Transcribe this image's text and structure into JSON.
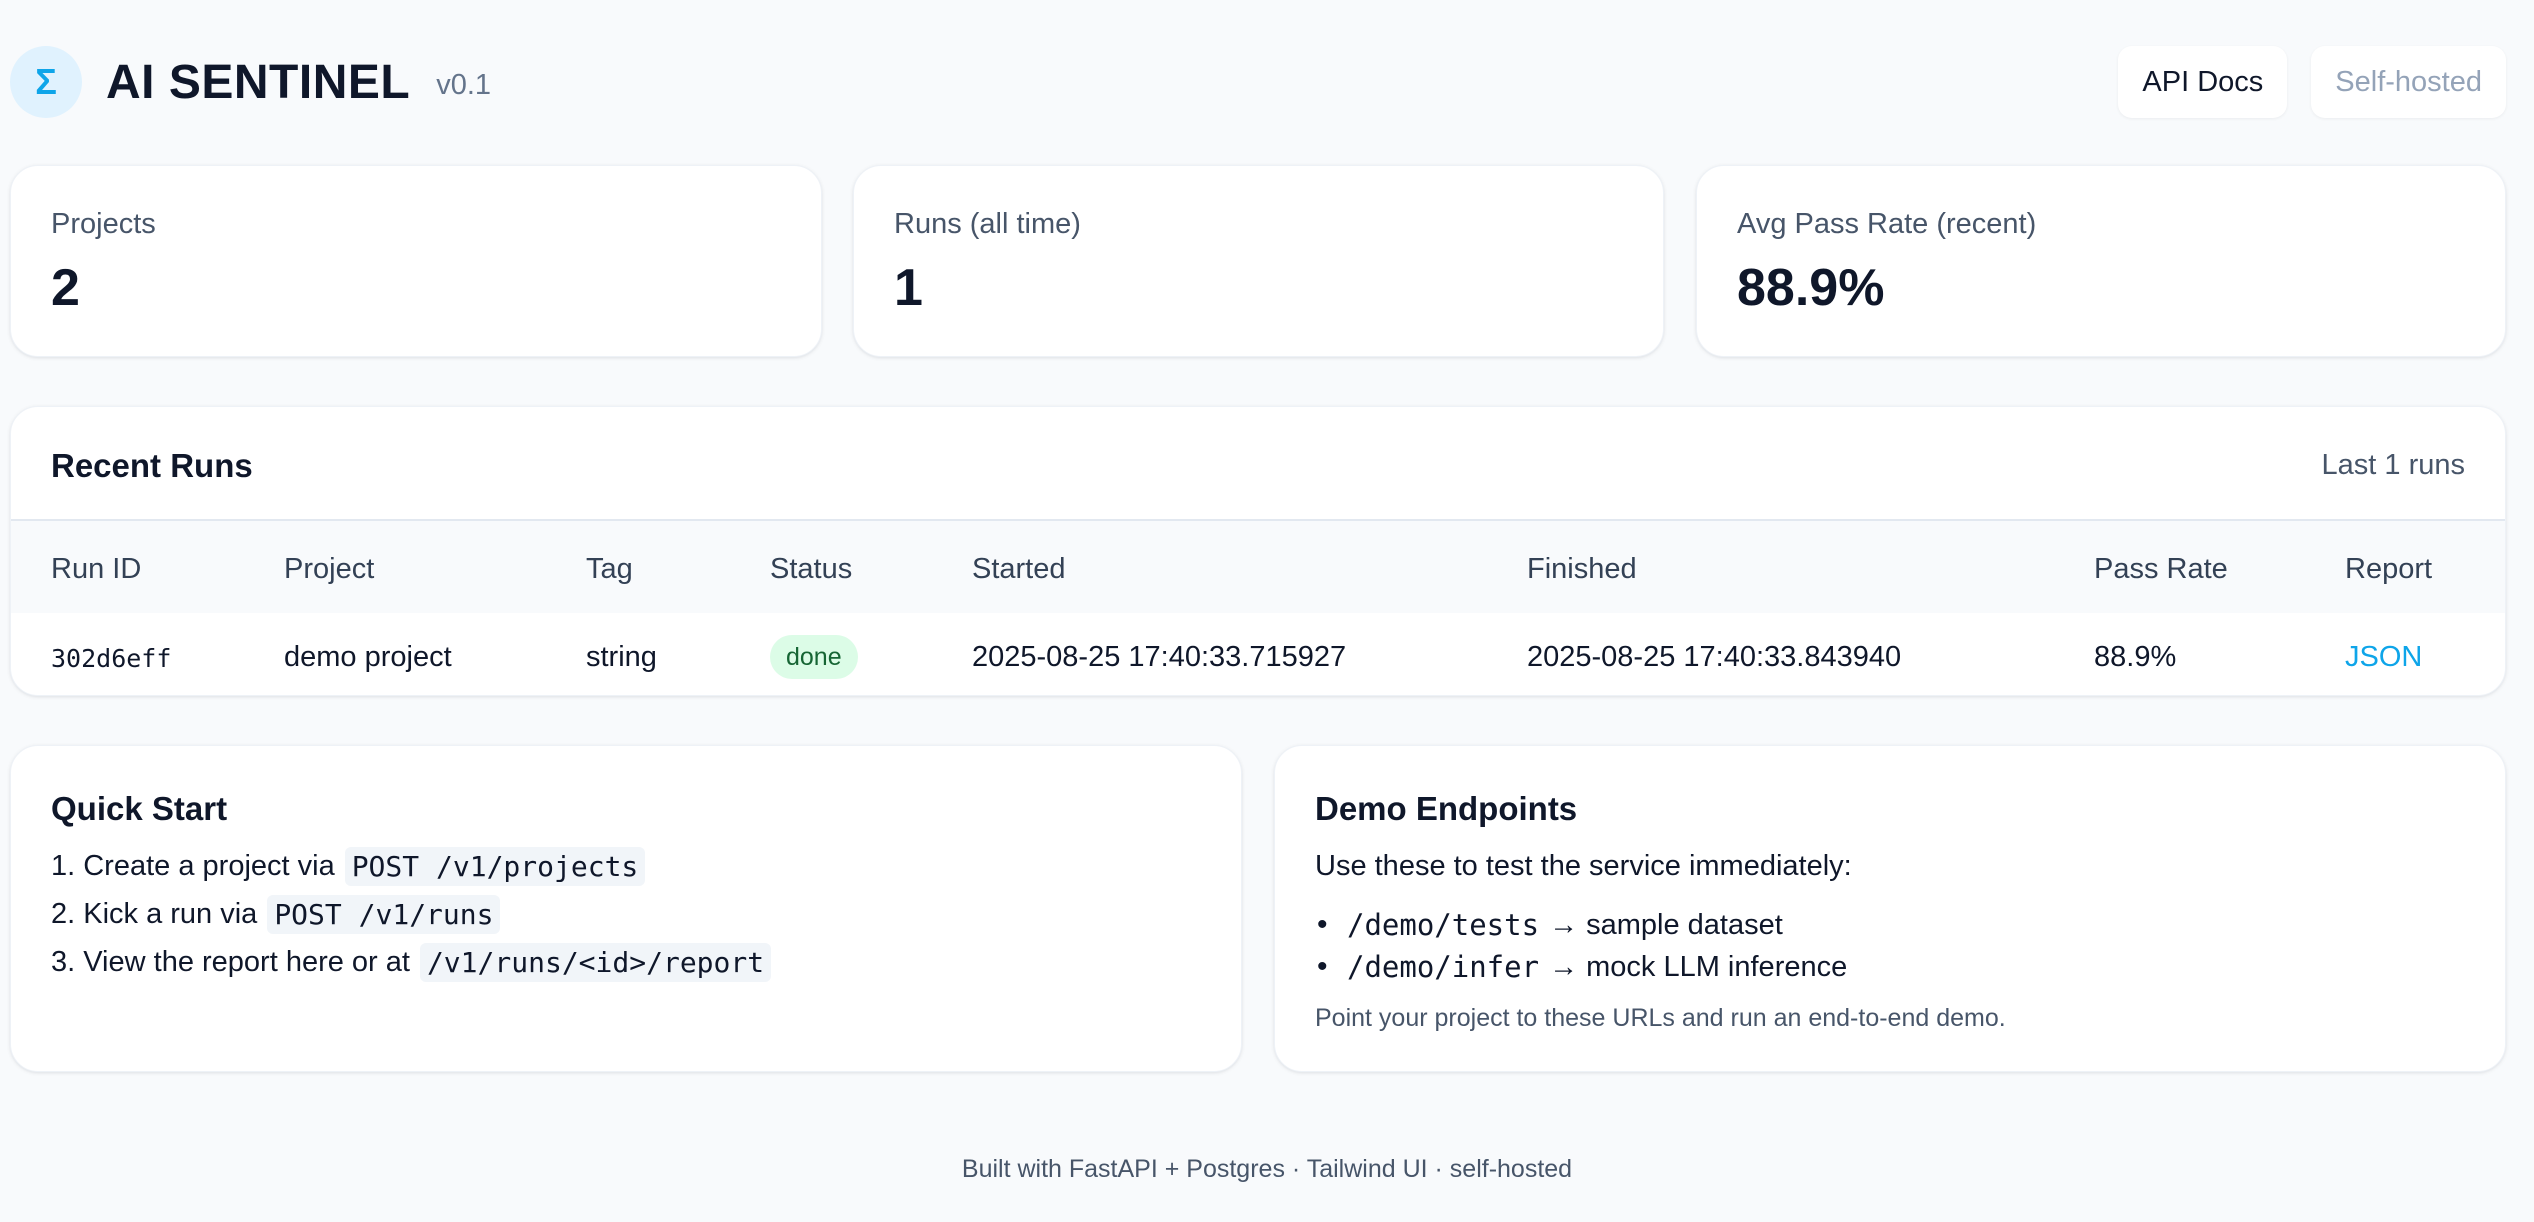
{
  "header": {
    "logo_glyph": "Σ",
    "title": "AI SENTINEL",
    "version": "v0.1",
    "api_docs_label": "API Docs",
    "self_hosted_label": "Self-hosted"
  },
  "stats": [
    {
      "label": "Projects",
      "value": "2"
    },
    {
      "label": "Runs (all time)",
      "value": "1"
    },
    {
      "label": "Avg Pass Rate (recent)",
      "value": "88.9%"
    }
  ],
  "recent_runs": {
    "title": "Recent Runs",
    "meta": "Last 1 runs",
    "columns": [
      "Run ID",
      "Project",
      "Tag",
      "Status",
      "Started",
      "Finished",
      "Pass Rate",
      "Report"
    ],
    "rows": [
      {
        "run_id": "302d6eff",
        "project": "demo project",
        "tag": "string",
        "status": "done",
        "started": "2025-08-25 17:40:33.715927",
        "finished": "2025-08-25 17:40:33.843940",
        "pass_rate": "88.9%",
        "report": "JSON"
      }
    ]
  },
  "quick_start": {
    "title": "Quick Start",
    "steps": [
      {
        "text": "1. Create a project via",
        "code": "POST /v1/projects"
      },
      {
        "text": "2. Kick a run via",
        "code": "POST /v1/runs"
      },
      {
        "text": "3. View the report here or at",
        "code": "/v1/runs/<id>/report"
      }
    ]
  },
  "demo_endpoints": {
    "title": "Demo Endpoints",
    "intro": "Use these to test the service immediately:",
    "items": [
      {
        "path": "/demo/tests",
        "desc": "→ sample dataset"
      },
      {
        "path": "/demo/infer",
        "desc": "→ mock LLM inference"
      }
    ],
    "note": "Point your project to these URLs and run an end-to-end demo."
  },
  "footer": "Built with FastAPI + Postgres · Tailwind UI · self-hosted",
  "colors": {
    "accent": "#0ea5e9",
    "background": "#f8fafc",
    "status_done_bg": "#dcfce7",
    "status_done_text": "#166534"
  }
}
